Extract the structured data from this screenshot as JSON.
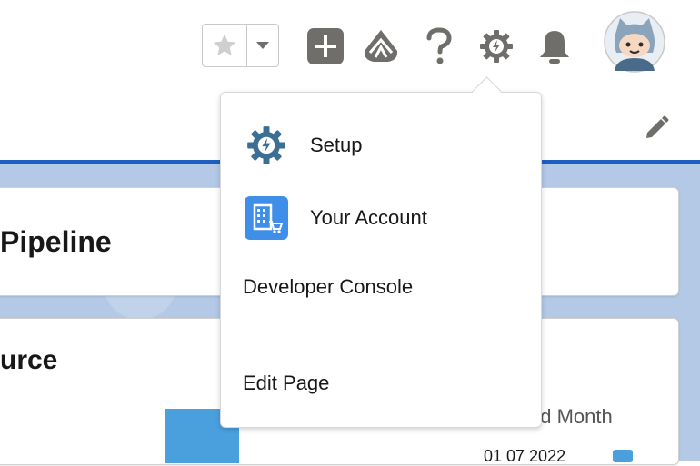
{
  "header": {
    "favorites_button": "favorites",
    "icons": [
      "star-icon",
      "chevron-down-icon",
      "add-icon",
      "trailhead-icon",
      "help-icon",
      "setup-gear-icon",
      "bell-icon",
      "avatar"
    ]
  },
  "background": {
    "card_1_title": "Pipeline",
    "card_2_title": "urce",
    "legend_label": "ed Month",
    "legend_date": "01 07 2022"
  },
  "menu": {
    "items": [
      {
        "label": "Setup",
        "icon": "setup-gear-icon"
      },
      {
        "label": "Your Account",
        "icon": "account-building-icon"
      },
      {
        "label": "Developer Console"
      },
      {
        "label": "Edit Page"
      }
    ]
  },
  "colors": {
    "accent_blue": "#1b5fc1",
    "setup_icon": "#3b6f94",
    "account_tile": "#3f8ee8",
    "icon_gray": "#706e6b"
  }
}
